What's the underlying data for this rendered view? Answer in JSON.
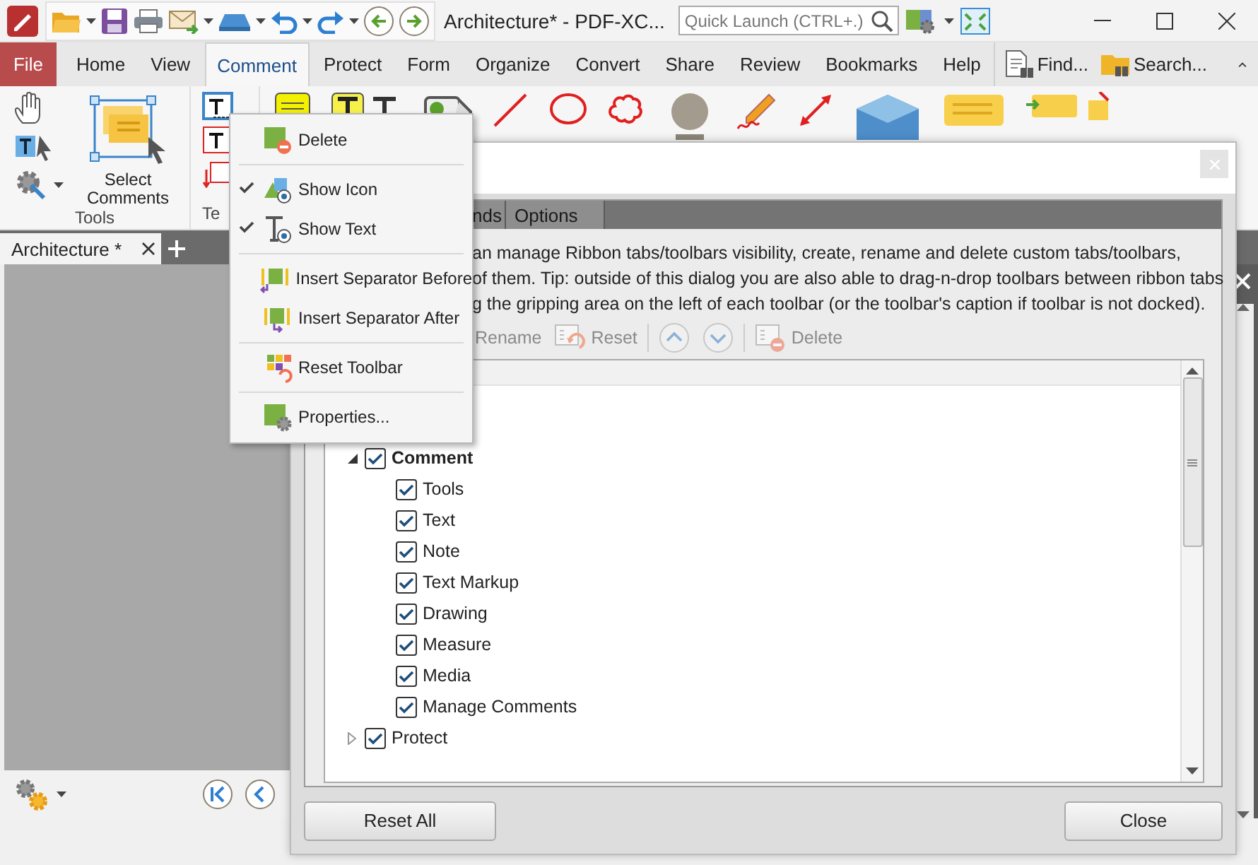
{
  "title_bar": {
    "title": "Architecture* - PDF-XC...",
    "quick_launch": {
      "placeholder": "Quick Launch (CTRL+.)"
    }
  },
  "ribbon_tabs": [
    {
      "label": "File",
      "kind": "file",
      "selected": false
    },
    {
      "label": "Home",
      "kind": "tab",
      "selected": false
    },
    {
      "label": "View",
      "kind": "tab",
      "selected": false
    },
    {
      "label": "Comment",
      "kind": "tab",
      "selected": true
    },
    {
      "label": "Protect",
      "kind": "tab",
      "selected": false
    },
    {
      "label": "Form",
      "kind": "tab",
      "selected": false
    },
    {
      "label": "Organize",
      "kind": "tab",
      "selected": false
    },
    {
      "label": "Convert",
      "kind": "tab",
      "selected": false
    },
    {
      "label": "Share",
      "kind": "tab",
      "selected": false
    },
    {
      "label": "Review",
      "kind": "tab",
      "selected": false
    },
    {
      "label": "Bookmarks",
      "kind": "tab",
      "selected": false
    },
    {
      "label": "Help",
      "kind": "tab",
      "selected": false
    }
  ],
  "ribbon_tools": [
    {
      "label": "Find..."
    },
    {
      "label": "Search..."
    }
  ],
  "ribbon_groups": [
    {
      "label": "Tools",
      "button": "Select Comments"
    },
    {
      "label": "Te"
    }
  ],
  "document_tabs": [
    {
      "label": "Architecture *",
      "selected": true
    }
  ],
  "dialog": {
    "tabs": [
      {
        "label": "nds",
        "selected": false
      },
      {
        "label": "Options",
        "selected": false
      }
    ],
    "description": [
      "an manage Ribbon tabs/toolbars visibility, create, rename and delete custom tabs/toolbars,",
      "of them. Tip: outside of this dialog you are also able to drag-n-drop toolbars between ribbon tabs",
      "g the gripping area on the left of each toolbar (or the toolbar's caption if toolbar is not docked)."
    ],
    "toolbar": [
      {
        "kind": "text",
        "label": "Rename",
        "disabled": true
      },
      {
        "kind": "text",
        "label": "Reset",
        "disabled": true
      },
      {
        "kind": "up",
        "disabled": true
      },
      {
        "kind": "down",
        "disabled": true
      },
      {
        "kind": "text",
        "label": "Delete",
        "disabled": true
      }
    ],
    "tree": [
      {
        "label": "Comment",
        "checked": true,
        "expanded": true,
        "bold": true,
        "children": [
          {
            "label": "Tools",
            "checked": true
          },
          {
            "label": "Text",
            "checked": true
          },
          {
            "label": "Note",
            "checked": true
          },
          {
            "label": "Text Markup",
            "checked": true
          },
          {
            "label": "Drawing",
            "checked": true
          },
          {
            "label": "Measure",
            "checked": true
          },
          {
            "label": "Media",
            "checked": true
          },
          {
            "label": "Manage Comments",
            "checked": true
          }
        ]
      },
      {
        "label": "Protect",
        "checked": true,
        "expanded": false,
        "bold": false
      }
    ],
    "buttons": [
      {
        "label": "Reset All"
      },
      {
        "label": "Close"
      }
    ]
  },
  "context_menu": [
    {
      "kind": "item",
      "label": "Delete",
      "checked": false
    },
    {
      "kind": "separator"
    },
    {
      "kind": "item",
      "label": "Show Icon",
      "checked": true
    },
    {
      "kind": "item",
      "label": "Show Text",
      "checked": true
    },
    {
      "kind": "separator"
    },
    {
      "kind": "item",
      "label": "Insert Separator Before",
      "checked": false
    },
    {
      "kind": "item",
      "label": "Insert Separator After",
      "checked": false
    },
    {
      "kind": "separator"
    },
    {
      "kind": "item",
      "label": "Reset Toolbar",
      "checked": false
    },
    {
      "kind": "separator"
    },
    {
      "kind": "item",
      "label": "Properties...",
      "checked": false
    }
  ]
}
